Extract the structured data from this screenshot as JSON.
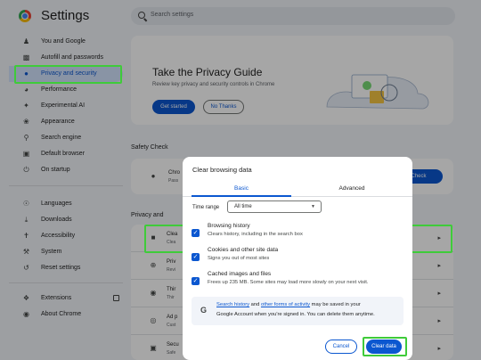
{
  "app": {
    "title": "Settings",
    "search_placeholder": "Search settings"
  },
  "sidebar": {
    "items": [
      {
        "label": "You and Google",
        "icon": "person-icon"
      },
      {
        "label": "Autofill and passwords",
        "icon": "clipboard-icon"
      },
      {
        "label": "Privacy and security",
        "icon": "shield-icon",
        "active": true
      },
      {
        "label": "Performance",
        "icon": "speedometer-icon"
      },
      {
        "label": "Experimental AI",
        "icon": "sparkle-icon"
      },
      {
        "label": "Appearance",
        "icon": "palette-icon"
      },
      {
        "label": "Search engine",
        "icon": "search-icon"
      },
      {
        "label": "Default browser",
        "icon": "browser-icon"
      },
      {
        "label": "On startup",
        "icon": "power-icon"
      },
      {
        "label": "Languages",
        "icon": "globe-icon"
      },
      {
        "label": "Downloads",
        "icon": "download-icon"
      },
      {
        "label": "Accessibility",
        "icon": "accessibility-icon"
      },
      {
        "label": "System",
        "icon": "wrench-icon"
      },
      {
        "label": "Reset settings",
        "icon": "reset-icon"
      },
      {
        "label": "Extensions",
        "icon": "puzzle-icon"
      },
      {
        "label": "About Chrome",
        "icon": "chrome-icon"
      }
    ]
  },
  "privacy_guide": {
    "title": "Take the Privacy Guide",
    "subtitle": "Review key privacy and security controls in Chrome",
    "get_started": "Get started",
    "no_thanks": "No Thanks"
  },
  "safety_check": {
    "title": "Safety Check",
    "row_t1": "Chro",
    "row_t2": "Pass",
    "button": "Check"
  },
  "privacy_section": {
    "title": "Privacy and",
    "rows": [
      {
        "t1": "Clea",
        "t2": "Clea"
      },
      {
        "t1": "Priv",
        "t2": "Revi"
      },
      {
        "t1": "Thir",
        "t2": "Thir"
      },
      {
        "t1": "Ad p",
        "t2": "Cust"
      },
      {
        "t1": "Secu",
        "t2": "Safe"
      }
    ]
  },
  "dialog": {
    "title": "Clear browsing data",
    "tabs": [
      "Basic",
      "Advanced"
    ],
    "time_range_label": "Time range",
    "time_range_value": "All time",
    "options": [
      {
        "title": "Browsing history",
        "desc": "Clears history, including in the search box",
        "checked": true
      },
      {
        "title": "Cookies and other site data",
        "desc": "Signs you out of most sites",
        "checked": true
      },
      {
        "title": "Cached images and files",
        "desc": "Frees up 235 MB. Some sites may load more slowly on your next visit.",
        "checked": true
      }
    ],
    "info": {
      "link1": "Search history",
      "text1": " and ",
      "link2": "other forms of activity",
      "text2": " may be saved in your",
      "line2": "Google Account when you're signed in. You can delete them anytime."
    },
    "cancel": "Cancel",
    "clear": "Clear data"
  },
  "colors": {
    "accent": "#0b57d0",
    "highlight": "#3fcb3a",
    "active_nav_bg": "#d3e3fd"
  }
}
